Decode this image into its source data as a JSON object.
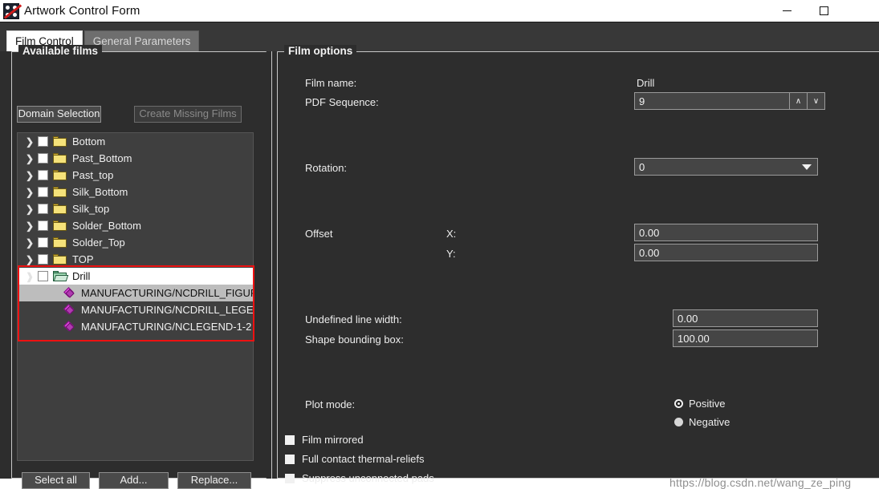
{
  "window": {
    "title": "Artwork Control Form",
    "app_icon": "dice-pcb-icon",
    "controls": {
      "minimize": "minimize-icon",
      "maximize": "maximize-icon",
      "close": "close-icon"
    }
  },
  "tabs": [
    {
      "label": "Film Control",
      "active": true
    },
    {
      "label": "General Parameters",
      "active": false
    }
  ],
  "available_films": {
    "group_title": "Available films",
    "buttons": {
      "domain_selection": "Domain Selection",
      "create_missing_films": "Create Missing Films"
    },
    "tree": [
      {
        "label": "Bottom",
        "type": "folder",
        "expanded": false,
        "checked": false,
        "indent": 0,
        "state": "normal"
      },
      {
        "label": "Past_Bottom",
        "type": "folder",
        "expanded": false,
        "checked": false,
        "indent": 0,
        "state": "normal"
      },
      {
        "label": "Past_top",
        "type": "folder",
        "expanded": false,
        "checked": false,
        "indent": 0,
        "state": "normal"
      },
      {
        "label": "Silk_Bottom",
        "type": "folder",
        "expanded": false,
        "checked": false,
        "indent": 0,
        "state": "normal"
      },
      {
        "label": "Silk_top",
        "type": "folder",
        "expanded": false,
        "checked": false,
        "indent": 0,
        "state": "normal"
      },
      {
        "label": "Solder_Bottom",
        "type": "folder",
        "expanded": false,
        "checked": false,
        "indent": 0,
        "state": "normal"
      },
      {
        "label": "Solder_Top",
        "type": "folder",
        "expanded": false,
        "checked": false,
        "indent": 0,
        "state": "normal"
      },
      {
        "label": "TOP",
        "type": "folder",
        "expanded": false,
        "checked": false,
        "indent": 0,
        "state": "normal"
      },
      {
        "label": "Drill",
        "type": "folder-open",
        "expanded": true,
        "checked": false,
        "indent": 0,
        "state": "selected-white"
      },
      {
        "label": "MANUFACTURING/NCDRILL_FIGURE",
        "type": "layer",
        "indent": 1,
        "state": "selected-grey"
      },
      {
        "label": "MANUFACTURING/NCDRILL_LEGEND",
        "type": "layer",
        "indent": 1,
        "state": "normal"
      },
      {
        "label": "MANUFACTURING/NCLEGEND-1-2",
        "type": "layer",
        "indent": 1,
        "state": "normal"
      }
    ],
    "bottom_buttons": {
      "select_all": "Select all",
      "add": "Add...",
      "replace": "Replace..."
    },
    "highlight_color": "#ee1111"
  },
  "film_options": {
    "group_title": "Film options",
    "film_name_label": "Film name:",
    "film_name_value": "Drill",
    "pdf_sequence_label": "PDF Sequence:",
    "pdf_sequence_value": "9",
    "spinner_up": "∧",
    "spinner_down": "∨",
    "rotation_label": "Rotation:",
    "rotation_value": "0",
    "offset_label": "Offset",
    "offset_x_label": "X:",
    "offset_x_value": "0.00",
    "offset_y_label": "Y:",
    "offset_y_value": "0.00",
    "undefined_line_width_label": "Undefined line width:",
    "undefined_line_width_value": "0.00",
    "shape_bounding_box_label": "Shape bounding box:",
    "shape_bounding_box_value": "100.00",
    "plot_mode_label": "Plot mode:",
    "plot_mode_options": [
      {
        "label": "Positive",
        "selected": true
      },
      {
        "label": "Negative",
        "selected": false
      }
    ],
    "checkboxes": [
      {
        "label": "Film mirrored",
        "checked": false
      },
      {
        "label": "Full contact thermal-reliefs",
        "checked": false
      },
      {
        "label": "Suppress unconnected pads",
        "checked": false
      }
    ]
  },
  "watermark": "https://blog.csdn.net/wang_ze_ping"
}
